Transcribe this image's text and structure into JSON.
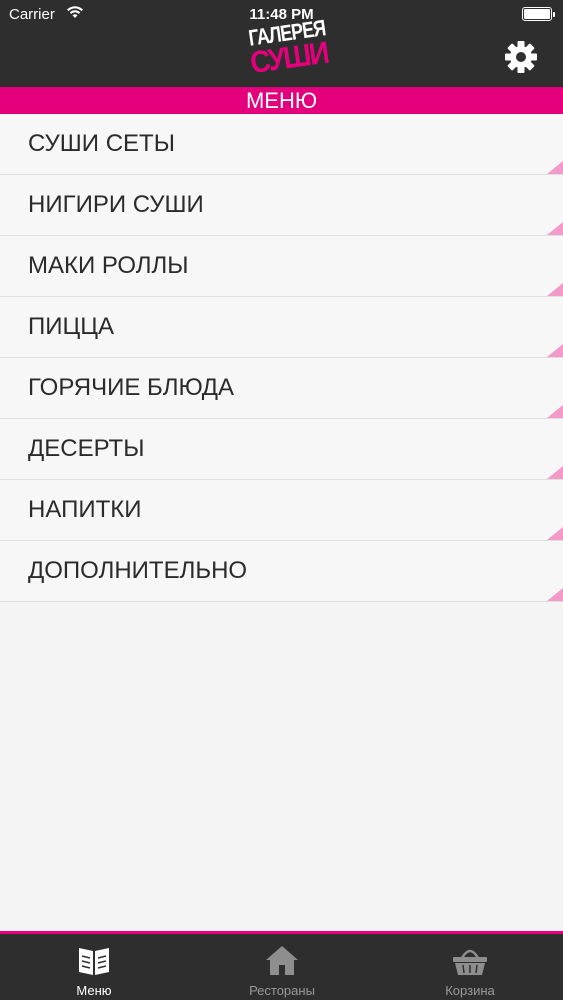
{
  "status_bar": {
    "carrier": "Carrier",
    "time": "11:48 PM"
  },
  "header": {
    "logo_line1": "ГАЛЕРЕЯ",
    "logo_line2": "СУШИ",
    "settings_icon": "gear-icon"
  },
  "section_title": "МЕНЮ",
  "menu_items": [
    {
      "label": "СУШИ СЕТЫ"
    },
    {
      "label": "НИГИРИ СУШИ"
    },
    {
      "label": "МАКИ РОЛЛЫ"
    },
    {
      "label": "ПИЦЦА"
    },
    {
      "label": "ГОРЯЧИЕ БЛЮДА"
    },
    {
      "label": "ДЕСЕРТЫ"
    },
    {
      "label": "НАПИТКИ"
    },
    {
      "label": "ДОПОЛНИТЕЛЬНО"
    }
  ],
  "tabs": [
    {
      "label": "Меню",
      "icon": "menu-book-icon",
      "active": true
    },
    {
      "label": "Рестораны",
      "icon": "home-icon",
      "active": false
    },
    {
      "label": "Корзина",
      "icon": "basket-icon",
      "active": false
    }
  ],
  "colors": {
    "accent": "#e4007c",
    "corner_accent": "#f29ac8",
    "bar_background": "#2e2e2e",
    "list_background": "#f7f7f7"
  }
}
